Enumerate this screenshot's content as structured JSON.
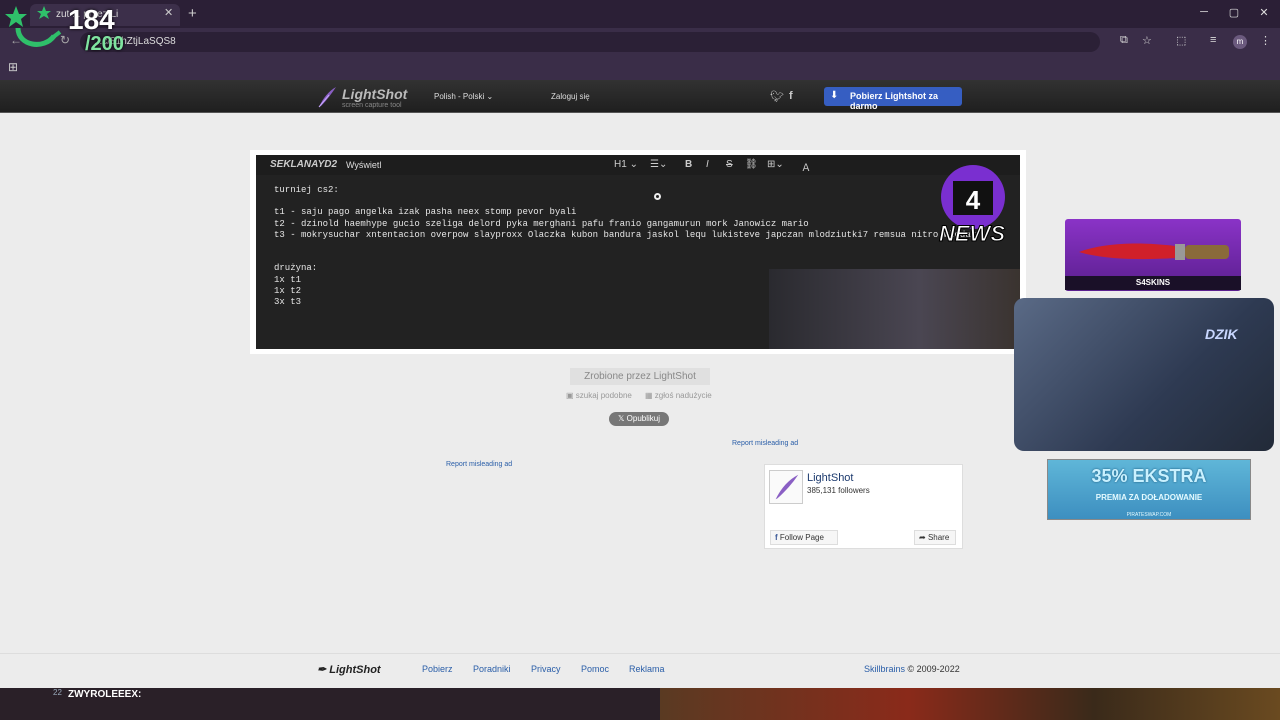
{
  "browser": {
    "tab_title": "zut ... przez Li",
    "url": "...c/81hZtjLaSQS8",
    "profile_initial": "m"
  },
  "overlay": {
    "counter_main": "184",
    "counter_total": "/200"
  },
  "header": {
    "logo": "LightShot",
    "logo_subtitle": "screen capture tool",
    "language": "Polish - Polski",
    "login": "Zaloguj się",
    "download_label": "Pobierz Lightshot za darmo"
  },
  "screenshot": {
    "brand": "SEKLANAYD2",
    "view_label": "Wyświetl",
    "toolbar_heading": "H1",
    "lines": [
      "turniej cs2:",
      "",
      "t1 - saju pago angelka izak pasha neex stomp pevor byali",
      "t2 - dzinold haemhype gucio szeliga delord pyka merghani pafu franio gangamurun mork Janowicz mario",
      "t3 - mokrysuchar xntentacion overpow slayproxx Olaczka kubon bandura jaskol lequ lukisteve japczan mlodziutki7 remsua nitro wlodar",
      "",
      "",
      "drużyna:",
      "1x t1",
      "1x t2",
      "3x t3"
    ],
    "news_label": "NEWS"
  },
  "below": {
    "made_by": "Zrobione przez LightShot",
    "search_similar": "szukaj podobne",
    "report_abuse": "zgłoś nadużycie",
    "publish": "Opublikuj",
    "report_ad_1": "Report misleading ad",
    "report_ad_2": "Report misleading ad"
  },
  "facebook": {
    "page_name": "LightShot",
    "followers": "385,131 followers",
    "follow": "Follow Page",
    "share": "Share"
  },
  "side": {
    "skins_label": "S4SKINS",
    "webcam_label": "DZIK",
    "promo_big": "35% EKSTRA",
    "promo_small": "PREMIA ZA DOŁADOWANIE",
    "promo_url": "PIRATESWAP.COM"
  },
  "footer": {
    "logo": "LightShot",
    "links": [
      "Pobierz",
      "Poradniki",
      "Privacy",
      "Pomoc",
      "Reklama"
    ],
    "company": "Skillbrains",
    "copyright": "© 2009-2022"
  },
  "chat": {
    "badge": "22",
    "username": "ZWYROLEEEX:"
  }
}
